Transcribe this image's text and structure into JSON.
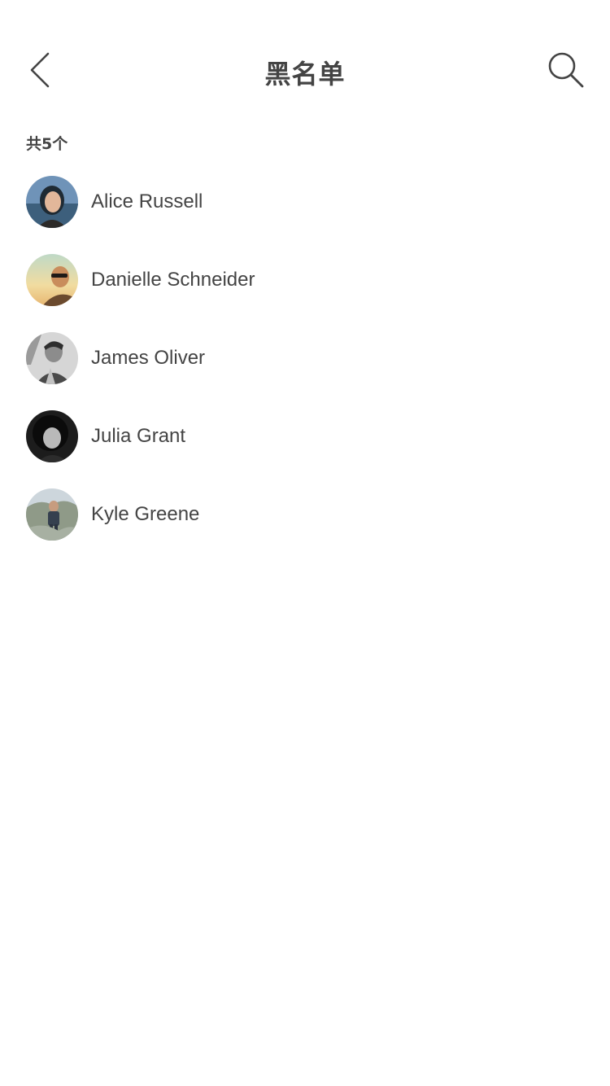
{
  "header": {
    "title": "黑名单",
    "back_icon": "chevron-left-icon",
    "search_icon": "search-icon"
  },
  "summary": {
    "count_label": "共5个"
  },
  "blacklist": [
    {
      "name": "Alice Russell",
      "avatar_colors": [
        "#5a7fa8",
        "#1f2a33",
        "#e2b79a"
      ]
    },
    {
      "name": "Danielle Schneider",
      "avatar_colors": [
        "#e9d9a6",
        "#2b2520",
        "#c98d5c"
      ]
    },
    {
      "name": "James Oliver",
      "avatar_colors": [
        "#cfcfcf",
        "#3a3a3a",
        "#8c8c8c"
      ]
    },
    {
      "name": "Julia Grant",
      "avatar_colors": [
        "#2a2a2a",
        "#0e0e0e",
        "#b3b3b3"
      ]
    },
    {
      "name": "Kyle Greene",
      "avatar_colors": [
        "#c6cfd6",
        "#3b4656",
        "#9aa58f"
      ]
    }
  ]
}
